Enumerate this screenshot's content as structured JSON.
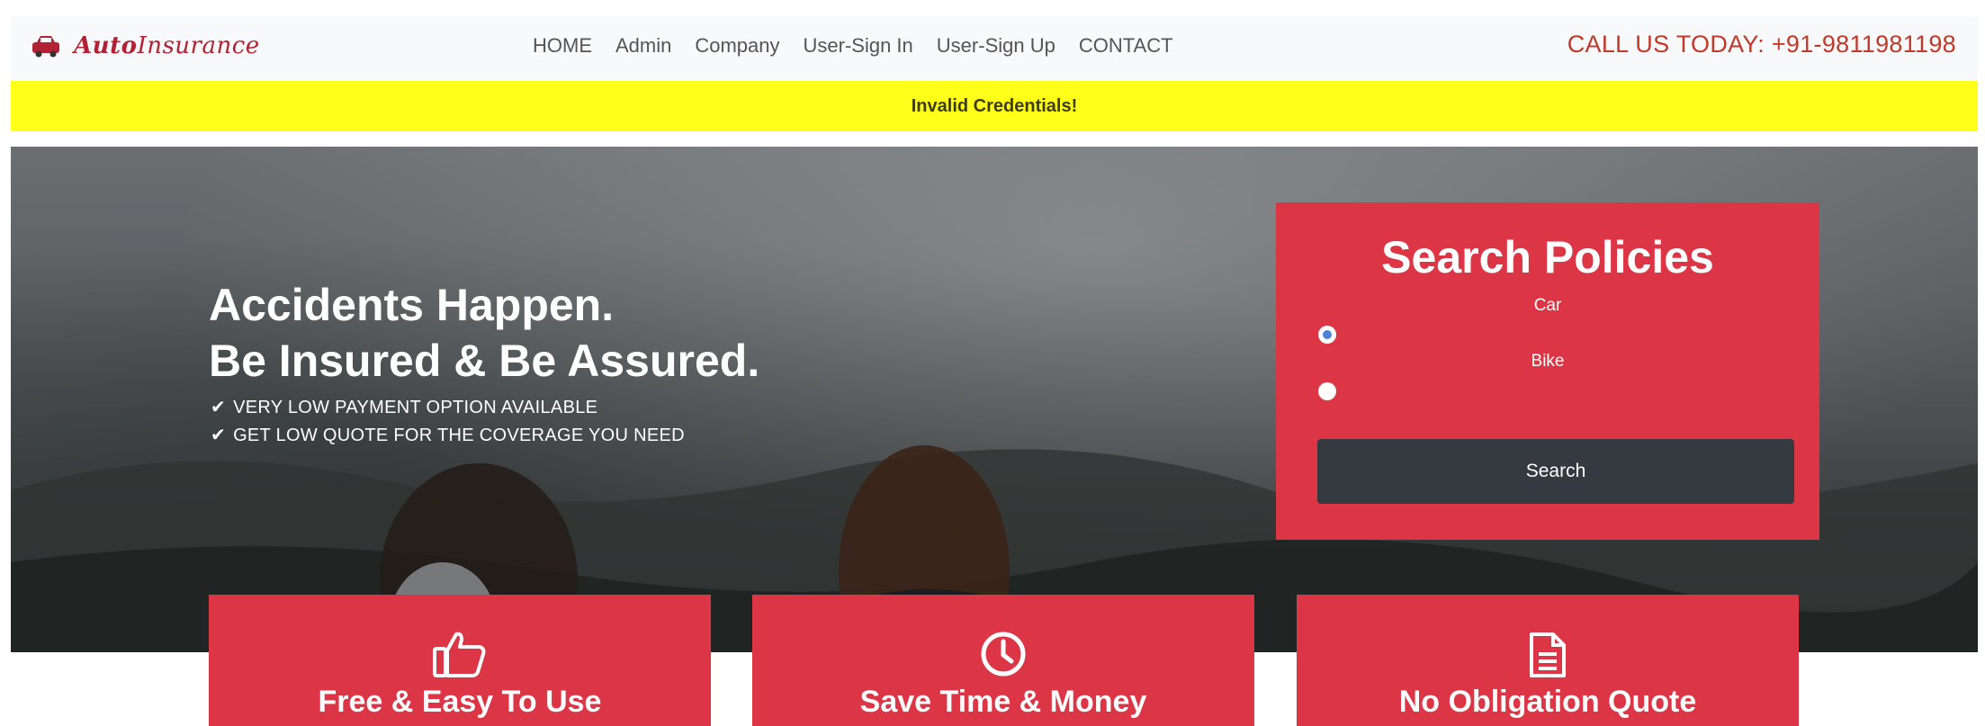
{
  "brand": {
    "name_bold": "Auto",
    "name_rest": "Insurance"
  },
  "nav": {
    "links": [
      "HOME",
      "Admin",
      "Company",
      "User-Sign In",
      "User-Sign Up",
      "CONTACT"
    ],
    "call_text": "CALL US TODAY: +91-9811981198"
  },
  "alert": {
    "message": "Invalid Credentials!"
  },
  "hero": {
    "headline_1": "Accidents Happen.",
    "headline_2": "Be Insured & Be Assured.",
    "bullets": [
      "VERY LOW PAYMENT OPTION AVAILABLE",
      "GET LOW QUOTE FOR THE COVERAGE YOU NEED"
    ]
  },
  "search": {
    "title": "Search Policies",
    "options": [
      {
        "label": "Car",
        "checked": true
      },
      {
        "label": "Bike",
        "checked": false
      }
    ],
    "button_label": "Search"
  },
  "features": [
    {
      "icon": "thumbs-up-icon",
      "title": "Free & Easy To Use"
    },
    {
      "icon": "clock-icon",
      "title": "Save Time & Money"
    },
    {
      "icon": "document-icon",
      "title": "No Obligation Quote"
    }
  ],
  "colors": {
    "accent": "#dc3545",
    "alert": "#ffff1a",
    "dark_button": "#343a40",
    "call_text": "#c0392b"
  }
}
